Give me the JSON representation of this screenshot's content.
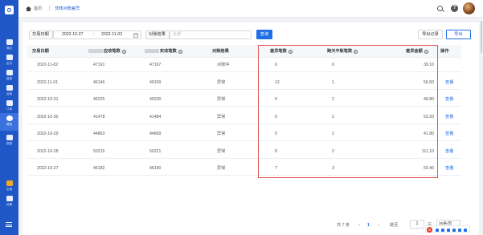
{
  "colors": {
    "primary": "#1f6fe8",
    "sidebar": "#1f57c6",
    "highlight_border": "#e05555",
    "link": "#1f6fe8"
  },
  "sidebar": {
    "items": [
      {
        "label": "首页",
        "icon": "home-icon"
      },
      {
        "label": "商品",
        "icon": "goods-icon"
      },
      {
        "label": "会员",
        "icon": "member-icon"
      },
      {
        "label": "营销",
        "icon": "marketing-icon"
      },
      {
        "label": "运营",
        "icon": "operation-icon"
      },
      {
        "label": "订单",
        "icon": "order-icon"
      },
      {
        "label": "财务",
        "icon": "finance-icon",
        "active": true
      },
      {
        "label": "数据",
        "icon": "data-icon"
      },
      {
        "label": "店铺",
        "icon": "store-icon"
      },
      {
        "label": "设置",
        "icon": "settings-icon"
      }
    ]
  },
  "header": {
    "home": "首页",
    "current": "非核对账差异"
  },
  "filters": {
    "date_label": "交易日期",
    "date_start": "2022-10-27",
    "date_sep": "~",
    "date_end": "2022-11-02",
    "result_label": "对账结果",
    "result_placeholder": "全部",
    "query_button": "查询",
    "export_record_button": "导出记录",
    "export_button": "导出"
  },
  "table": {
    "columns": [
      "交易日期",
      "应收笔数",
      "实收笔数",
      "对账结果",
      "差异笔数",
      "跨天平账笔数",
      "差异金额",
      "操作"
    ],
    "rows": [
      {
        "date": "2022-11-02",
        "receivable": "47191",
        "received": "47197",
        "result": "对账中",
        "diff_count": "6",
        "cross_day": "0",
        "diff_amount": "39.10",
        "action": ""
      },
      {
        "date": "2022-11-01",
        "receivable": "46146",
        "received": "46159",
        "result": "异常",
        "diff_count": "12",
        "cross_day": "1",
        "diff_amount": "56.50",
        "action": "查看"
      },
      {
        "date": "2022-10-31",
        "receivable": "45225",
        "received": "45230",
        "result": "异常",
        "diff_count": "5",
        "cross_day": "2",
        "diff_amount": "48.80",
        "action": "查看"
      },
      {
        "date": "2022-10-30",
        "receivable": "41478",
        "received": "41484",
        "result": "异常",
        "diff_count": "6",
        "cross_day": "2",
        "diff_amount": "53.20",
        "action": "查看"
      },
      {
        "date": "2022-10-29",
        "receivable": "44863",
        "received": "44869",
        "result": "异常",
        "diff_count": "5",
        "cross_day": "1",
        "diff_amount": "41.80",
        "action": "查看"
      },
      {
        "date": "2022-10-28",
        "receivable": "50215",
        "received": "50221",
        "result": "异常",
        "diff_count": "8",
        "cross_day": "2",
        "diff_amount": "111.10",
        "action": "查看"
      },
      {
        "date": "2022-10-27",
        "receivable": "46182",
        "received": "46190",
        "result": "异常",
        "diff_count": "7",
        "cross_day": "3",
        "diff_amount": "59.40",
        "action": "查看"
      }
    ]
  },
  "pagination": {
    "total": "共 7 条",
    "prev": "‹",
    "page": "1",
    "next": "›",
    "goto_label": "跳至",
    "goto_value": "1",
    "page_unit": "页",
    "page_size": "30条/页"
  }
}
